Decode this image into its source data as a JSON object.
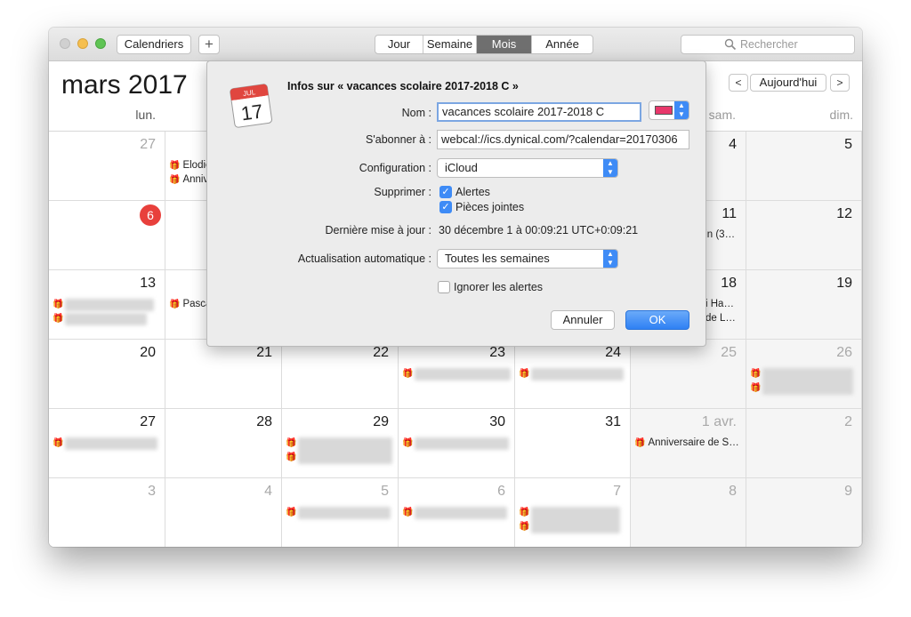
{
  "toolbar": {
    "calendars_label": "Calendriers",
    "add_label": "+",
    "views": [
      "Jour",
      "Semaine",
      "Mois",
      "Année"
    ],
    "active_view": "Mois",
    "search_placeholder": "Rechercher"
  },
  "header": {
    "month_title": "mars 2017",
    "prev": "<",
    "today": "Aujourd'hui",
    "next": ">",
    "days": [
      "lun.",
      "sam.",
      "dim."
    ]
  },
  "grid": {
    "row1": [
      "27",
      "",
      "",
      "",
      "",
      "4",
      "5"
    ],
    "row2": [
      "6",
      "",
      "",
      "",
      "",
      "11",
      "12"
    ],
    "row3": [
      "13",
      "",
      "",
      "",
      "",
      "18",
      "19"
    ],
    "row4": [
      "20",
      "21",
      "22",
      "23",
      "24",
      "25",
      "26"
    ],
    "row5": [
      "27",
      "28",
      "29",
      "30",
      "31",
      "1 avr.",
      "2"
    ],
    "row6": [
      "3",
      "4",
      "5",
      "6",
      "7",
      "8",
      "9"
    ]
  },
  "events": {
    "elodie": "Elodie",
    "anniv": "Anniv",
    "pasca": "Pasca",
    "tin3": "tin (3…",
    "iha": "i Ha…",
    "del": "de L…",
    "anniversaire_s": "Anniversaire de S…",
    "gift": "🎁"
  },
  "popover": {
    "title": "Infos sur « vacances scolaire  2017-2018 C »",
    "name_label": "Nom :",
    "name_value": "vacances scolaire  2017-2018 C",
    "subscribe_label": "S'abonner à :",
    "subscribe_value": "webcal://ics.dynical.com/?calendar=20170306",
    "config_label": "Configuration :",
    "config_value": "iCloud",
    "remove_label": "Supprimer :",
    "remove_alerts": "Alertes",
    "remove_attachments": "Pièces jointes",
    "last_update_label": "Dernière mise à jour :",
    "last_update_value": "30 décembre 1 à 00:09:21 UTC+0:09:21",
    "refresh_label": "Actualisation automatique :",
    "refresh_value": "Toutes les semaines",
    "ignore_alerts": "Ignorer les alertes",
    "cancel": "Annuler",
    "ok": "OK",
    "icon_month": "JUL",
    "icon_day": "17",
    "calendar_color": "#e8386b"
  }
}
